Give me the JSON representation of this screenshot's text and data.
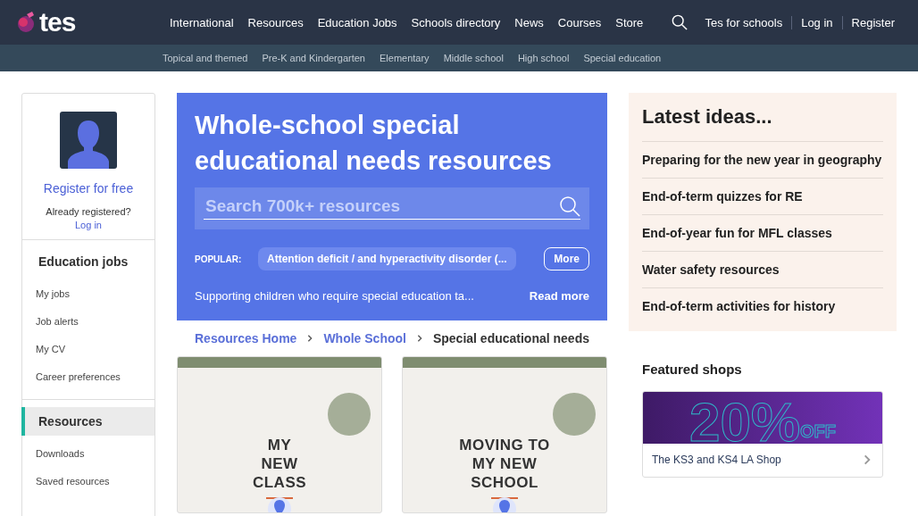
{
  "header": {
    "logo": "tes",
    "nav": [
      {
        "label": "International"
      },
      {
        "label": "Resources"
      },
      {
        "label": "Education Jobs"
      },
      {
        "label": "Schools directory"
      },
      {
        "label": "News"
      },
      {
        "label": "Courses"
      },
      {
        "label": "Store"
      }
    ],
    "account_links": [
      "Tes for schools",
      "Log in",
      "Register"
    ]
  },
  "subnav": [
    "Topical and themed",
    "Pre-K and Kindergarten",
    "Elementary",
    "Middle school",
    "High school",
    "Special education"
  ],
  "sidebar": {
    "register_link": "Register for free",
    "already_text": "Already registered?",
    "login_link": "Log in",
    "sections": [
      {
        "title": "Education jobs",
        "selected": false,
        "items": [
          "My jobs",
          "Job alerts",
          "My CV",
          "Career preferences"
        ]
      },
      {
        "title": "Resources",
        "selected": true,
        "items": [
          "Downloads",
          "Saved resources"
        ]
      }
    ]
  },
  "hero": {
    "title": "Whole-school special educational needs resources",
    "search": {
      "placeholder": "Search 700k+ resources"
    },
    "popular_label": "POPULAR:",
    "popular_tag": "Attention deficit / and hyperactivity disorder (...",
    "more_button": "More",
    "description": "Supporting children who require special education ta...",
    "read_more": "Read more"
  },
  "breadcrumb": [
    {
      "label": "Resources Home",
      "kind": "link"
    },
    {
      "label": "Whole School",
      "kind": "link"
    },
    {
      "label": "Special educational needs",
      "kind": "current"
    }
  ],
  "resources": [
    {
      "title_lines": [
        "MY",
        "NEW",
        "CLASS"
      ]
    },
    {
      "title_lines": [
        "MOVING TO",
        "MY NEW",
        "SCHOOL"
      ]
    }
  ],
  "latest_ideas": {
    "title": "Latest ideas...",
    "items": [
      "Preparing for the new year in geography",
      "End-of-term quizzes for RE",
      "End-of-year fun for MFL classes",
      "Water safety resources",
      "End-of-term activities for history"
    ]
  },
  "featured_shops": {
    "title": "Featured shops",
    "banner": {
      "big": "20%",
      "small": "OFF"
    },
    "shop_name": "The KS3 and KS4 LA Shop"
  }
}
